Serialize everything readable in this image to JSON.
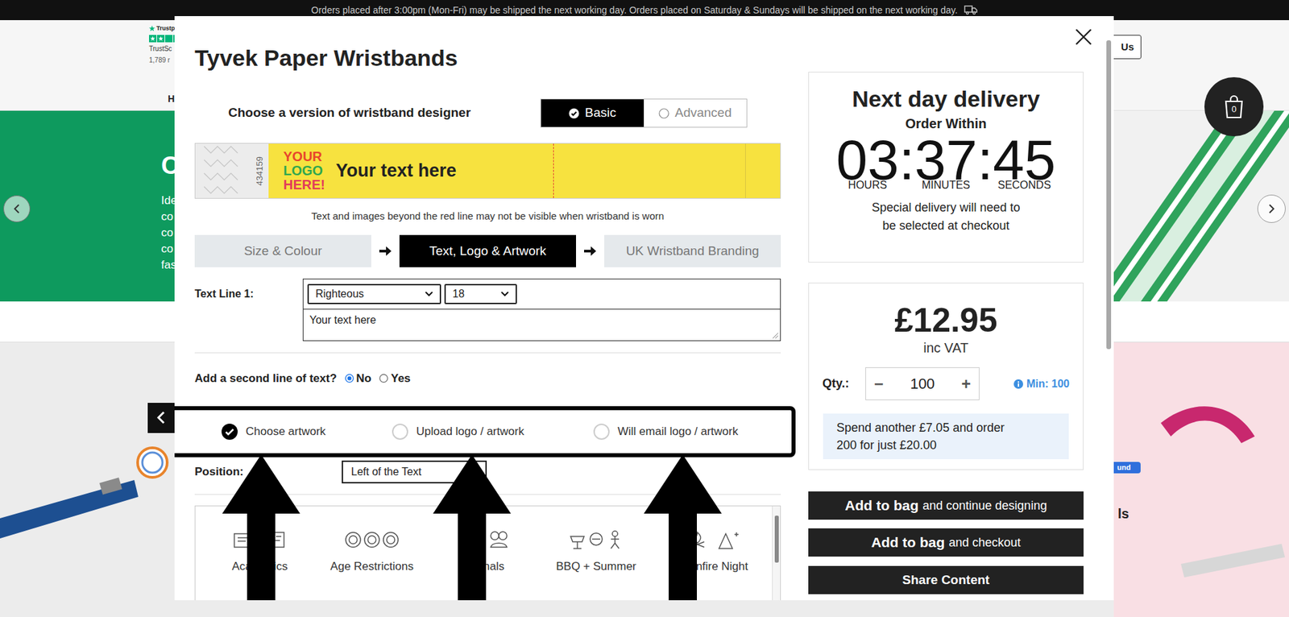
{
  "announcement": "Orders placed after 3:00pm (Mon-Fri) may be shipped the next working day. Orders placed on Saturday & Sundays will be shipped on the next working day.",
  "background": {
    "trustpilot": {
      "brand": "Trustp",
      "label": "TrustSc",
      "count": "1,789 r"
    },
    "nav_item": "H",
    "contact_button": "Us",
    "bag_count": "0",
    "banner": {
      "heading": "C",
      "lines": [
        "Ide",
        "co",
        "co",
        "co",
        "fas"
      ]
    },
    "badge": "und",
    "card_title": "ls"
  },
  "designer": {
    "title": "Tyvek Paper Wristbands",
    "version_label": "Choose a version of wristband designer",
    "versions": [
      {
        "label": "Basic",
        "selected": true
      },
      {
        "label": "Advanced",
        "selected": false
      }
    ],
    "preview": {
      "serial": "434159",
      "logo": [
        {
          "text": "YOUR",
          "color": "#e8452c"
        },
        {
          "text": "LOGO",
          "color": "#2fa84f"
        },
        {
          "text": "HERE!",
          "color": "#e23b5a"
        }
      ],
      "text": "Your text here"
    },
    "note": "Text and images beyond the red line may not be visible when wristband is worn",
    "steps": [
      {
        "label": "Size & Colour",
        "selected": false
      },
      {
        "label": "Text, Logo & Artwork",
        "selected": true
      },
      {
        "label": "UK Wristband Branding",
        "selected": false
      }
    ],
    "text_line": {
      "label": "Text Line 1:",
      "font": "Righteous",
      "size": "18",
      "value": "Your text here"
    },
    "second_line": {
      "question": "Add a second line of text?",
      "options": [
        {
          "label": "No",
          "selected": true
        },
        {
          "label": "Yes",
          "selected": false
        }
      ]
    },
    "artwork_options": [
      {
        "label": "Choose artwork",
        "selected": true
      },
      {
        "label": "Upload logo / artwork",
        "selected": false
      },
      {
        "label": "Will email logo / artwork",
        "selected": false
      }
    ],
    "position": {
      "label": "Position:",
      "value": "Left of the Text"
    },
    "categories": [
      "Academics",
      "Age Restrictions",
      "Animals",
      "BBQ + Summer",
      "Bonfire Night"
    ]
  },
  "delivery": {
    "title": "Next day delivery",
    "subtitle": "Order Within",
    "timer": [
      {
        "value": "03",
        "unit": "HOURS"
      },
      {
        "value": "37",
        "unit": "MINUTES"
      },
      {
        "value": "45",
        "unit": "SECONDS"
      }
    ],
    "separator": ":",
    "note": [
      "Special delivery will need to",
      "be selected at checkout"
    ]
  },
  "price": {
    "amount": "£12.95",
    "tax": "inc VAT",
    "qty_label": "Qty.:",
    "decrement": "−",
    "qty": "100",
    "increment": "+",
    "minimum": "Min: 100",
    "upsell": [
      "Spend another £7.05 and order",
      "200 for just £20.00"
    ]
  },
  "actions": [
    {
      "bold": "Add to bag",
      "text": "and continue designing"
    },
    {
      "bold": "Add to bag",
      "text": "and checkout"
    }
  ],
  "share": "Share Content"
}
